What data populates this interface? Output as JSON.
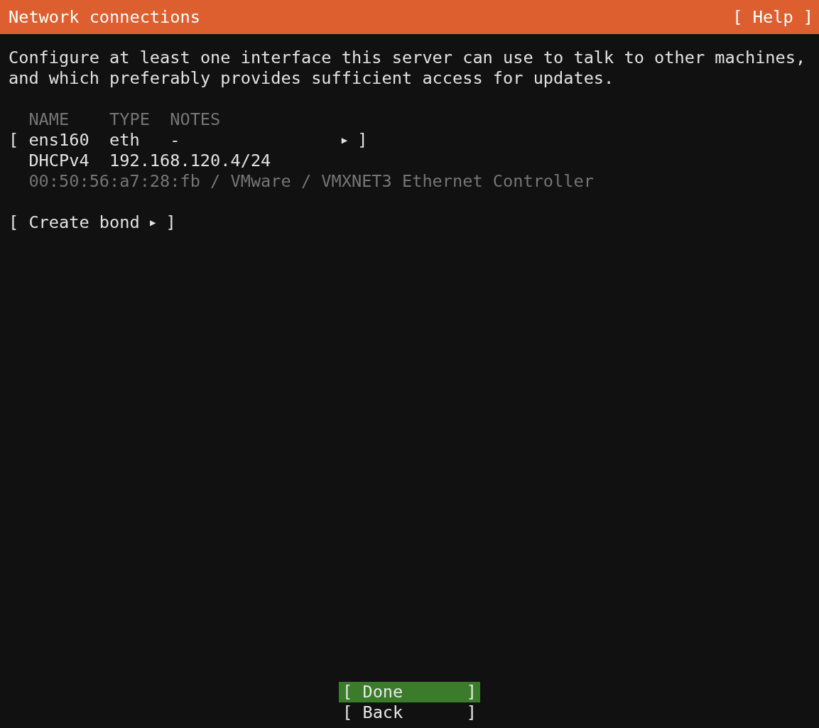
{
  "header": {
    "title": "Network connections",
    "help": "[ Help ]"
  },
  "description": "Configure at least one interface this server can use to talk to other machines, and which preferably provides sufficient access for updates.",
  "brackets": [
    "[",
    "]"
  ],
  "table": {
    "columns": [
      "NAME",
      "TYPE",
      "NOTES"
    ],
    "interfaces": [
      {
        "name": "ens160",
        "type": "eth",
        "notes": "-",
        "arrow": "▶",
        "address_method": "DHCPv4",
        "address": "192.168.120.4/24",
        "hardware": "00:50:56:a7:28:fb / VMware / VMXNET3 Ethernet Controller"
      }
    ]
  },
  "create_bond": {
    "label": "Create bond",
    "arrow": "▶"
  },
  "buttons": [
    {
      "label": "Done",
      "selected": true
    },
    {
      "label": "Back",
      "selected": false
    }
  ]
}
